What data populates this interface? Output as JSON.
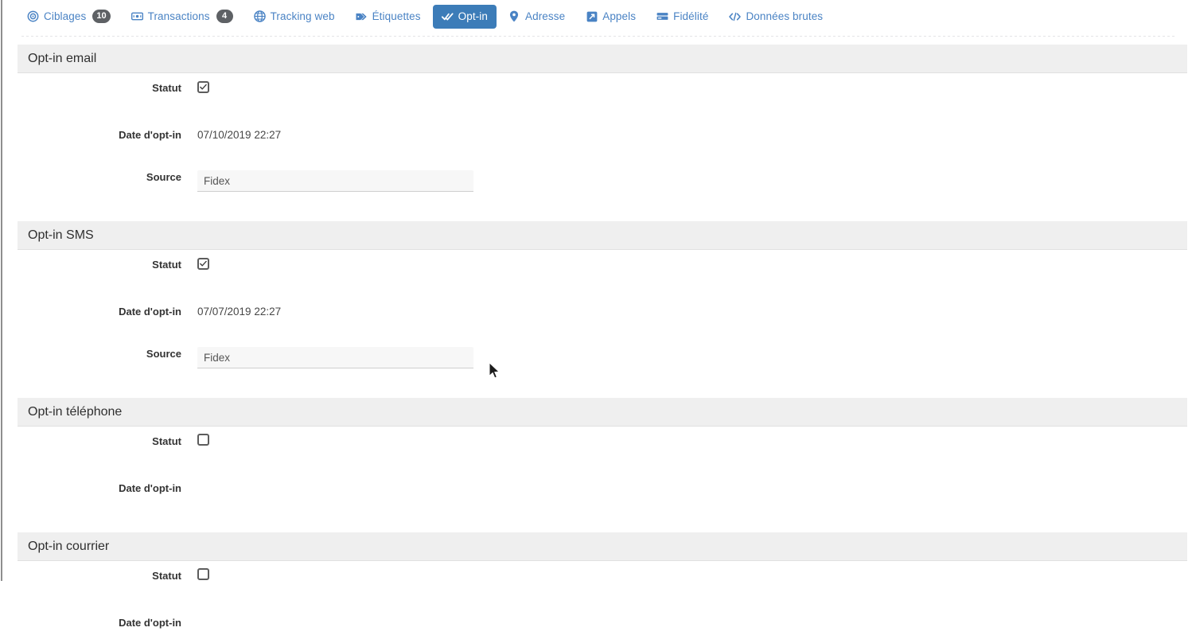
{
  "tabs": [
    {
      "label": "Ciblages",
      "icon": "target-icon",
      "badge": "10",
      "active": false
    },
    {
      "label": "Transactions",
      "icon": "banknote-icon",
      "badge": "4",
      "active": false
    },
    {
      "label": "Tracking web",
      "icon": "globe-icon",
      "badge": null,
      "active": false
    },
    {
      "label": "Étiquettes",
      "icon": "tags-icon",
      "badge": null,
      "active": false
    },
    {
      "label": "Opt-in",
      "icon": "double-check-icon",
      "badge": null,
      "active": true
    },
    {
      "label": "Adresse",
      "icon": "map-pin-icon",
      "badge": null,
      "active": false
    },
    {
      "label": "Appels",
      "icon": "call-icon",
      "badge": null,
      "active": false
    },
    {
      "label": "Fidélité",
      "icon": "loyalty-card-icon",
      "badge": null,
      "active": false
    },
    {
      "label": "Données brutes",
      "icon": "code-icon",
      "badge": null,
      "active": false
    }
  ],
  "labels": {
    "statut": "Statut",
    "date_opt_in": "Date d'opt-in",
    "source": "Source"
  },
  "sections": [
    {
      "title": "Opt-in email",
      "statut_checked": true,
      "date": "07/10/2019 22:27",
      "source_value": "Fidex",
      "source_placeholder": "",
      "has_source": true
    },
    {
      "title": "Opt-in SMS",
      "statut_checked": true,
      "date": "07/07/2019 22:27",
      "source_value": "Fidex",
      "source_placeholder": "",
      "has_source": true
    },
    {
      "title": "Opt-in téléphone",
      "statut_checked": false,
      "date": "",
      "source_value": "",
      "source_placeholder": "",
      "has_source": false
    },
    {
      "title": "Opt-in courrier",
      "statut_checked": false,
      "date": "",
      "source_value": "",
      "source_placeholder": "",
      "has_source": false
    }
  ],
  "colors": {
    "tab_link": "#4a83c4",
    "tab_active_bg": "#3c7cb8",
    "badge_bg": "#5e6165",
    "section_header_bg": "#efefef",
    "input_bg": "#f7f7f7"
  }
}
